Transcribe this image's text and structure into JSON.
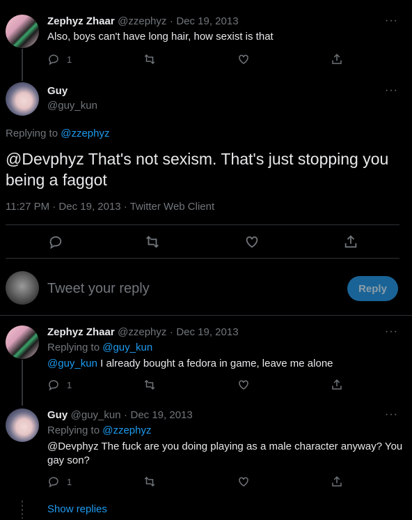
{
  "tweet1": {
    "name": "Zephyz Zhaar",
    "handle": "@zzephyz",
    "dot": "·",
    "date": "Dec 19, 2013",
    "text": "Also, boys can't have long hair, how sexist is that",
    "reply_count": "1",
    "more": "···"
  },
  "main_tweet": {
    "name": "Guy",
    "handle": "@guy_kun",
    "replying_prefix": "Replying to",
    "replying_to": "@zzephyz",
    "text": "@Devphyz That's not sexism. That's just stopping you being a faggot",
    "meta": "11:27 PM · Dec 19, 2013 · Twitter Web Client",
    "more": "···"
  },
  "compose": {
    "placeholder": "Tweet your reply",
    "button": "Reply"
  },
  "reply1": {
    "name": "Zephyz Zhaar",
    "handle": "@zzephyz",
    "dot": "·",
    "date": "Dec 19, 2013",
    "replying_prefix": "Replying to",
    "replying_to": "@guy_kun",
    "mention": "@guy_kun",
    "text": " I already bought a fedora in game, leave me alone",
    "reply_count": "1",
    "more": "···"
  },
  "reply2": {
    "name": "Guy",
    "handle": "@guy_kun",
    "dot": "·",
    "date": "Dec 19, 2013",
    "replying_prefix": "Replying to",
    "replying_to": "@zzephyz",
    "text_line1": "@Devphyz The fuck are you doing playing as a male character anyway? You",
    "text_line2": "gay son?",
    "reply_count": "1",
    "more": "···"
  },
  "show_replies": "Show replies",
  "colors": {
    "background": "#000000",
    "text": "#e7e9ea",
    "muted": "#71767b",
    "link": "#1d9bf0",
    "reply_button": "#1a6396"
  },
  "icons": [
    "reply-icon",
    "retweet-icon",
    "like-icon",
    "share-icon",
    "more-icon"
  ]
}
